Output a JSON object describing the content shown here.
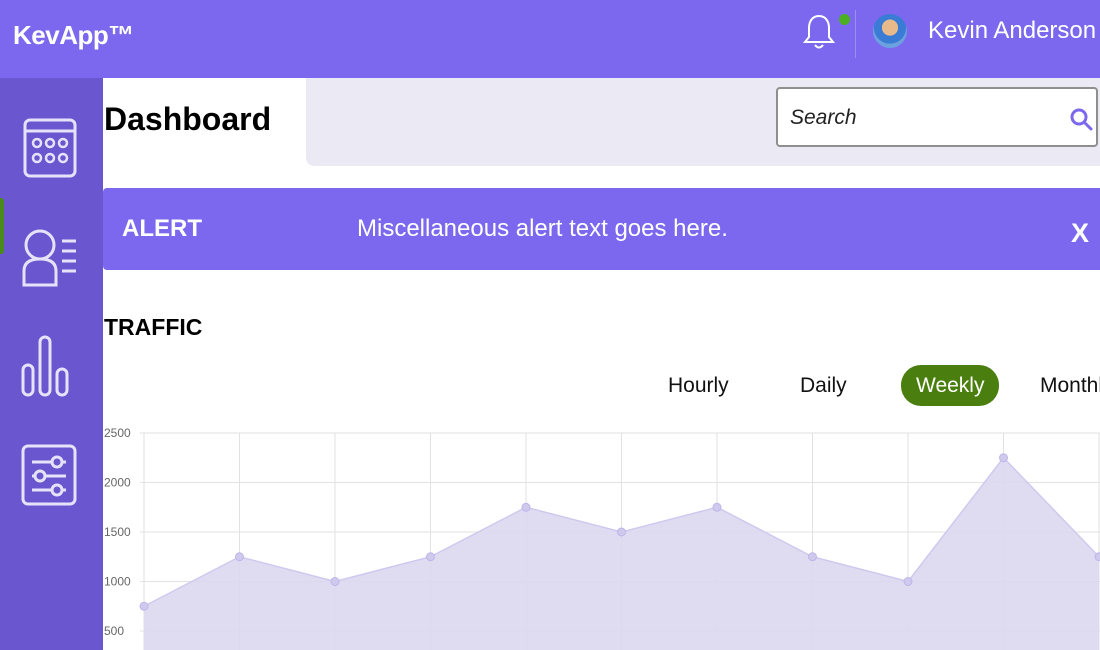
{
  "app": {
    "name": "KevApp™"
  },
  "user": {
    "name": "Kevin Anderson",
    "avatar_icon": "user-avatar"
  },
  "notifications": {
    "icon": "bell-icon",
    "has_unread": true,
    "unread_color": "#4caf22"
  },
  "sidebar": {
    "items": [
      {
        "name": "calendar",
        "icon": "calendar-icon",
        "active": true
      },
      {
        "name": "users",
        "icon": "user-list-icon",
        "active": false
      },
      {
        "name": "analytics",
        "icon": "bar-chart-icon",
        "active": false
      },
      {
        "name": "settings",
        "icon": "sliders-icon",
        "active": false
      }
    ]
  },
  "page": {
    "title": "Dashboard"
  },
  "search": {
    "placeholder": "Search"
  },
  "alert": {
    "label": "ALERT",
    "text": "Miscellaneous alert text goes here.",
    "close_label": "X"
  },
  "traffic": {
    "title": "TRAFFIC",
    "ranges": [
      "Hourly",
      "Daily",
      "Weekly",
      "Monthly"
    ],
    "selected_range": "Weekly"
  },
  "colors": {
    "brand": "#7b68ee",
    "sidebar": "#6a56cf",
    "active_green": "#4a7f10",
    "chart_fill": "#dcd8f1"
  },
  "chart_data": {
    "type": "area",
    "x": [
      1,
      2,
      3,
      4,
      5,
      6,
      7,
      8,
      9,
      10,
      11
    ],
    "values": [
      750,
      1250,
      1000,
      1250,
      1750,
      1500,
      1750,
      1250,
      1000,
      2250,
      1250
    ],
    "yticks": [
      "2500",
      "2000",
      "1500",
      "1000",
      "500"
    ],
    "ylim": [
      0,
      2500
    ],
    "grid": true
  }
}
